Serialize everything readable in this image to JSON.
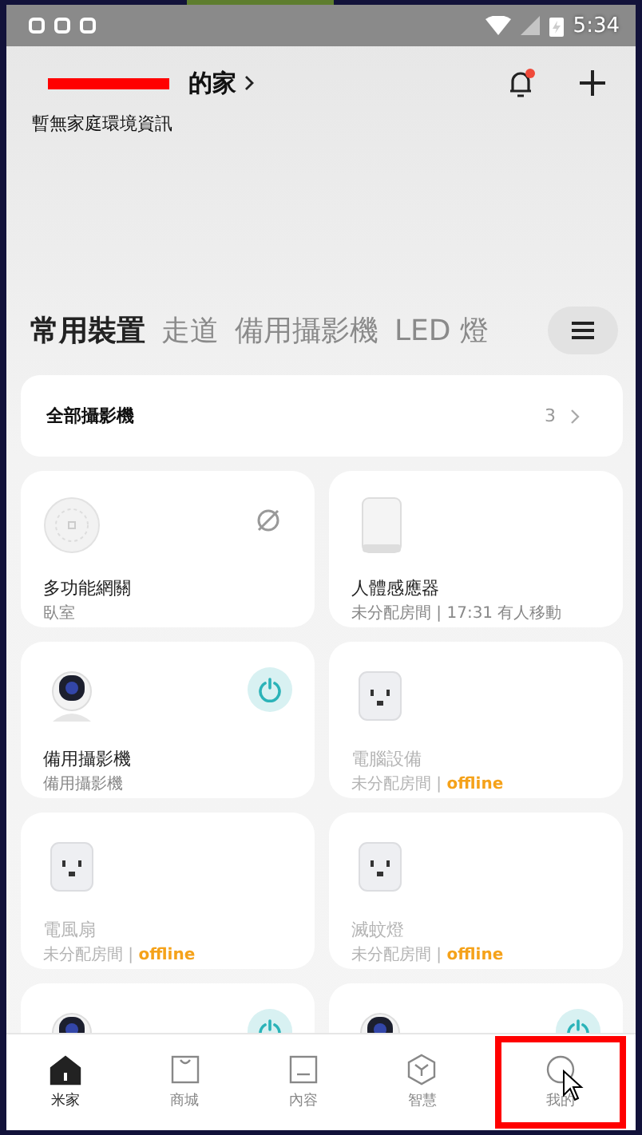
{
  "status_bar": {
    "time": "5:34"
  },
  "header": {
    "home_name": "的家",
    "subtitle": "暫無家庭環境資訊",
    "notification_dot": true
  },
  "tabs": [
    {
      "label": "常用裝置",
      "selected": true
    },
    {
      "label": "走道",
      "selected": false
    },
    {
      "label": "備用攝影機",
      "selected": false
    },
    {
      "label": "LED 燈",
      "selected": false
    }
  ],
  "camera_group": {
    "title": "全部攝影機",
    "count": "3"
  },
  "devices": [
    {
      "kind": "gateway",
      "name": "多功能網關",
      "room": "臥室"
    },
    {
      "kind": "sensor",
      "name": "人體感應器",
      "room": "未分配房間 | 17:31 有人移動"
    },
    {
      "kind": "camera",
      "name": "備用攝影機",
      "room": "備用攝影機"
    },
    {
      "kind": "plug",
      "name": "電腦設備",
      "room": "未分配房間 | ",
      "status": "offline"
    },
    {
      "kind": "plug",
      "name": "電風扇",
      "room": "未分配房間 | ",
      "status": "offline"
    },
    {
      "kind": "plug",
      "name": "滅蚊燈",
      "room": "未分配房間 | ",
      "status": "offline"
    },
    {
      "kind": "camera"
    },
    {
      "kind": "camera"
    }
  ],
  "bottom_nav": [
    {
      "label": "米家",
      "selected": true
    },
    {
      "label": "商城",
      "selected": false
    },
    {
      "label": "內容",
      "selected": false
    },
    {
      "label": "智慧",
      "selected": false
    },
    {
      "label": "我的",
      "selected": false,
      "highlighted": true
    }
  ]
}
